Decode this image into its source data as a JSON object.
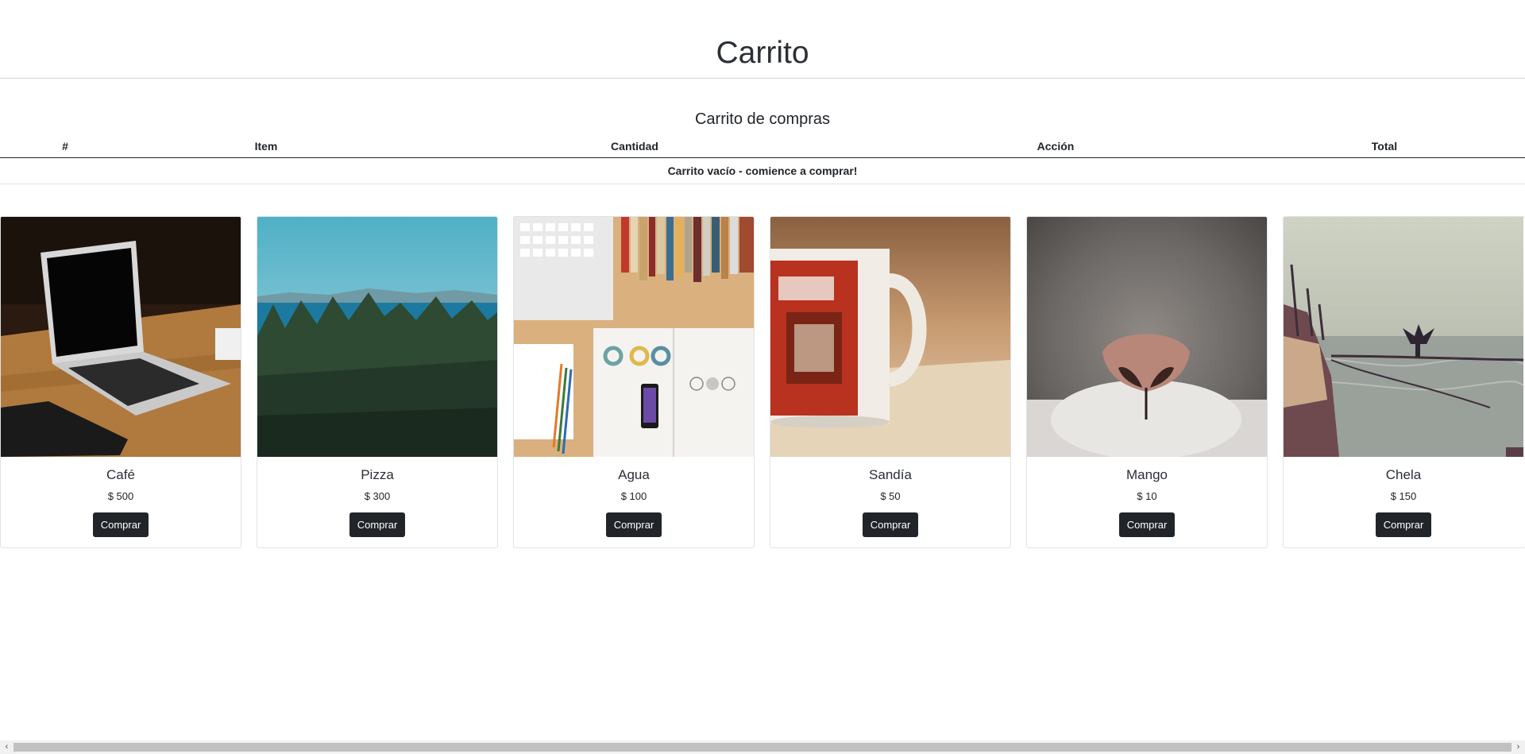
{
  "header": {
    "title": "Carrito"
  },
  "cart": {
    "title": "Carrito de compras",
    "columns": {
      "index": "#",
      "item": "Item",
      "quantity": "Cantidad",
      "action": "Acción",
      "total": "Total"
    },
    "empty_message": "Carrito vacío - comience a comprar!"
  },
  "products": [
    {
      "name": "Café",
      "price": "$ 500",
      "button": "Comprar",
      "image": "laptop-on-desk-photo"
    },
    {
      "name": "Pizza",
      "price": "$ 300",
      "button": "Comprar",
      "image": "forest-and-lake-photo"
    },
    {
      "name": "Agua",
      "price": "$ 100",
      "button": "Comprar",
      "image": "desk-flatlay-photo"
    },
    {
      "name": "Sandía",
      "price": "$ 50",
      "button": "Comprar",
      "image": "coffee-mug-photo"
    },
    {
      "name": "Mango",
      "price": "$ 10",
      "button": "Comprar",
      "image": "cat-nose-photo"
    },
    {
      "name": "Chela",
      "price": "$ 150",
      "button": "Comprar",
      "image": "bird-on-boat-photo"
    }
  ],
  "scrollbar": {
    "left_arrow": "‹",
    "right_arrow": "›"
  },
  "colors": {
    "button_bg": "#212529",
    "text": "#212529",
    "border": "#dfe2e5"
  }
}
